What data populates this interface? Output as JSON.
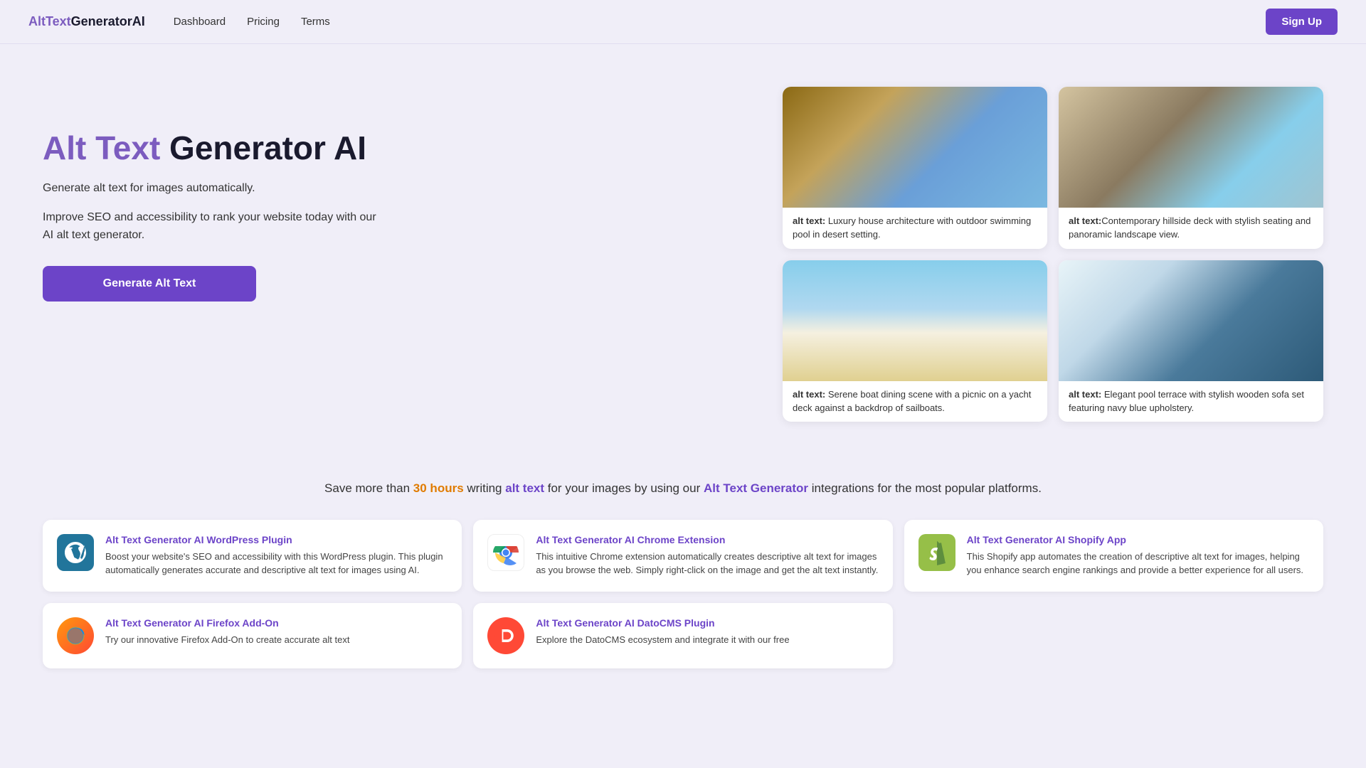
{
  "nav": {
    "logo_alt": "AltText",
    "logo_gen": "GeneratorAI",
    "links": [
      {
        "label": "Dashboard",
        "id": "dashboard"
      },
      {
        "label": "Pricing",
        "id": "pricing"
      },
      {
        "label": "Terms",
        "id": "terms"
      }
    ],
    "signup": "Sign Up"
  },
  "hero": {
    "title_colored": "Alt Text",
    "title_dark": " Generator AI",
    "subtitle": "Generate alt text for images automatically.",
    "description": "Improve SEO and accessibility to rank your website today with our AI alt text generator.",
    "cta_button": "Generate Alt Text"
  },
  "images": [
    {
      "caption_bold": "alt text:",
      "caption_text": " Luxury house architecture with outdoor swimming pool in desert setting."
    },
    {
      "caption_bold": "alt text:",
      "caption_text": "Contemporary hillside deck with stylish seating and panoramic landscape view."
    },
    {
      "caption_bold": "alt text:",
      "caption_text": " Serene boat dining scene with a picnic on a yacht deck against a backdrop of sailboats."
    },
    {
      "caption_bold": "alt text:",
      "caption_text": " Elegant pool terrace with stylish wooden sofa set featuring navy blue upholstery."
    }
  ],
  "integrations": {
    "text_before": "Save more than ",
    "hours": "30 hours",
    "text_mid": " writing ",
    "alt_text_link": "alt text",
    "text_mid2": " for your images by using our ",
    "generator_link": "Alt Text Generator",
    "text_end": " integrations for the most popular platforms."
  },
  "plugins": [
    {
      "id": "wordpress",
      "title": "Alt Text Generator AI WordPress Plugin",
      "desc": "Boost your website's SEO and accessibility with this WordPress plugin. This plugin automatically generates accurate and descriptive alt text for images using AI.",
      "icon": "wp"
    },
    {
      "id": "chrome",
      "title": "Alt Text Generator AI Chrome Extension",
      "desc": "This intuitive Chrome extension automatically creates descriptive alt text for images as you browse the web. Simply right-click on the image and get the alt text instantly.",
      "icon": "chrome"
    },
    {
      "id": "shopify",
      "title": "Alt Text Generator AI Shopify App",
      "desc": "This Shopify app automates the creation of descriptive alt text for images, helping you enhance search engine rankings and provide a better experience for all users.",
      "icon": "shopify"
    },
    {
      "id": "firefox",
      "title": "Alt Text Generator AI Firefox Add-On",
      "desc": "Try our innovative Firefox Add-On to create accurate alt text",
      "icon": "firefox"
    },
    {
      "id": "datocms",
      "title": "Alt Text Generator AI DatoCMS Plugin",
      "desc": "Explore the DatoCMS ecosystem and integrate it with our free",
      "icon": "dato"
    }
  ]
}
